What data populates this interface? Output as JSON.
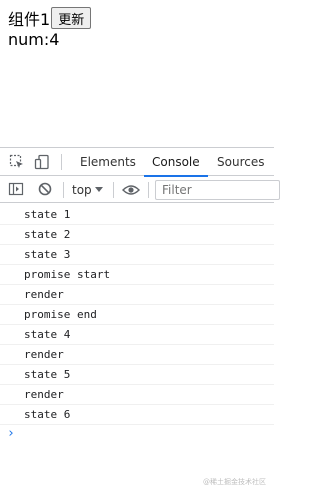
{
  "app": {
    "component_label": "组件1",
    "update_button": "更新",
    "num_line": "num:4"
  },
  "devtools": {
    "tabs": [
      "Elements",
      "Console",
      "Sources"
    ],
    "active_tab": "Console",
    "context_selector": "top",
    "filter_placeholder": "Filter",
    "icons": [
      "inspect-element-icon",
      "device-toolbar-icon",
      "sidebar-toggle-icon",
      "clear-console-icon",
      "eye-icon"
    ]
  },
  "console": {
    "logs": [
      "state 1",
      "state 2",
      "state 3",
      "promise start",
      "render",
      "promise end",
      "state 4",
      "render",
      "state 5",
      "render",
      "state 6"
    ],
    "prompt": "›"
  },
  "watermark": "@稀土掘金技术社区",
  "colors": {
    "accent": "#1a73e8",
    "border": "#cbcdd1"
  }
}
